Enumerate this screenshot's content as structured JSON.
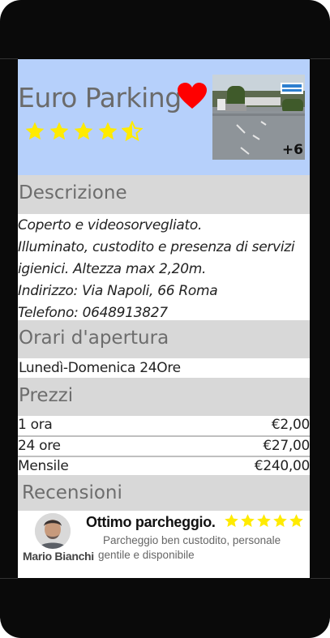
{
  "parking": {
    "name": "Euro Parking",
    "rating": 4.5,
    "favorite": true,
    "photos_more": "+6"
  },
  "description": {
    "heading": "Descrizione",
    "lines": [
      "Coperto e videosorvegliato.",
      "Illuminato, custodito e presenza di servizi",
      "igienici.  Altezza max 2,20m.",
      "Indirizzo: Via  Napoli, 66 Roma",
      "Telefono: 0648913827"
    ]
  },
  "hours": {
    "heading": "Orari d'apertura",
    "text": "Lunedì-Domenica 24Ore"
  },
  "prices": {
    "heading": "Prezzi",
    "rows": [
      {
        "label": "1 ora",
        "value": "€2,00"
      },
      {
        "label": "24 ore",
        "value": "€27,00"
      },
      {
        "label": "Mensile",
        "value": "€240,00"
      }
    ]
  },
  "reviews": {
    "heading": "Recensioni",
    "items": [
      {
        "author": "Mario Bianchi",
        "title": "Ottimo parcheggio.",
        "stars": 5,
        "text_line1": "Parcheggio ben custodito,  personale",
        "text_line2": "gentile e disponibile"
      }
    ]
  },
  "colors": {
    "header_bg": "#b6d0fb",
    "section_bg": "#d8d8d8",
    "star": "#ffeb00",
    "heart": "#ff0000"
  }
}
